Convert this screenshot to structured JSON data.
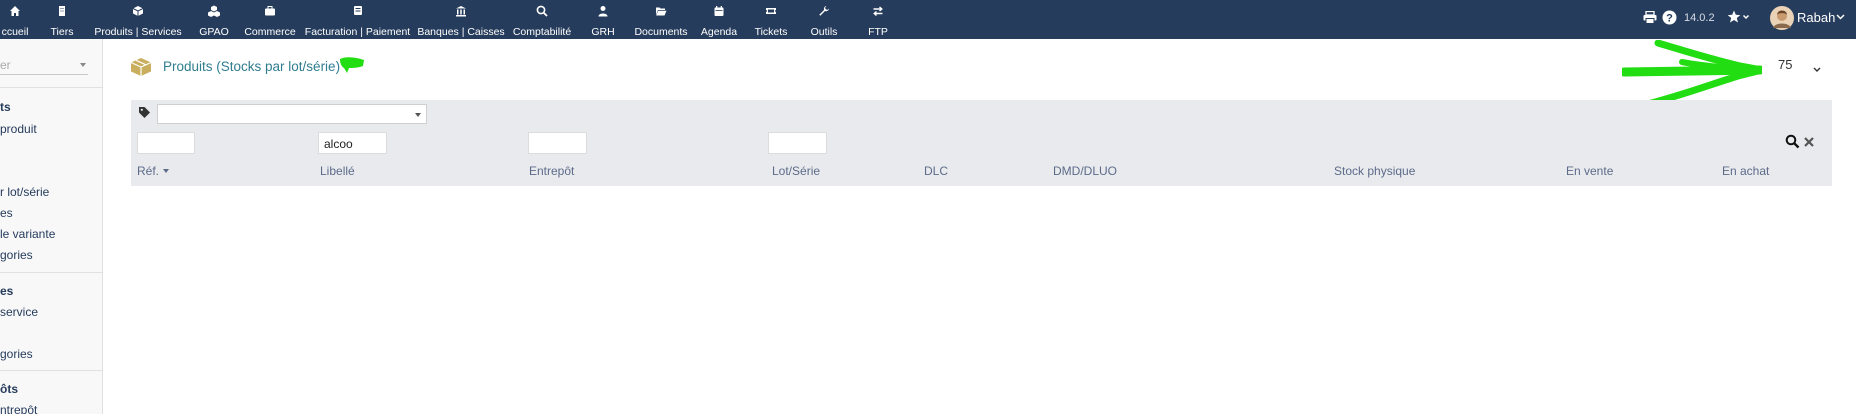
{
  "nav": {
    "items": [
      {
        "label": "ccueil",
        "icon": "home-icon"
      },
      {
        "label": "Tiers",
        "icon": "building-icon"
      },
      {
        "label": "Produits | Services",
        "icon": "cube-icon"
      },
      {
        "label": "GPAO",
        "icon": "cubes-icon"
      },
      {
        "label": "Commerce",
        "icon": "briefcase-icon"
      },
      {
        "label": "Facturation | Paiement",
        "icon": "money-check-icon"
      },
      {
        "label": "Banques | Caisses",
        "icon": "bank-icon"
      },
      {
        "label": "Comptabilité",
        "icon": "search-dollar-icon"
      },
      {
        "label": "GRH",
        "icon": "user-tie-icon"
      },
      {
        "label": "Documents",
        "icon": "folder-open-icon"
      },
      {
        "label": "Agenda",
        "icon": "calendar-icon"
      },
      {
        "label": "Tickets",
        "icon": "ticket-icon"
      },
      {
        "label": "Outils",
        "icon": "wrench-icon"
      },
      {
        "label": "FTP",
        "icon": "exchange-icon"
      }
    ],
    "version": "14.0.2",
    "user": "Rabah"
  },
  "sidebar": {
    "search_placeholder": "er",
    "items": [
      {
        "label": "ts",
        "kind": "head"
      },
      {
        "label": "produit",
        "kind": "link"
      },
      {
        "label": "r lot/série",
        "kind": "link"
      },
      {
        "label": "es",
        "kind": "link"
      },
      {
        "label": "le variante",
        "kind": "link"
      },
      {
        "label": "gories",
        "kind": "link"
      },
      {
        "label": "es",
        "kind": "head"
      },
      {
        "label": "service",
        "kind": "link"
      },
      {
        "label": "gories",
        "kind": "link"
      },
      {
        "label": "ôts",
        "kind": "head"
      },
      {
        "label": "ntrepôt",
        "kind": "link"
      }
    ]
  },
  "main": {
    "title": "Produits (Stocks par lot/série)",
    "limit": "75",
    "filters": {
      "ref": "",
      "label": "alcoo",
      "warehouse": "",
      "lot": ""
    },
    "columns": {
      "ref": "Réf.",
      "label": "Libellé",
      "warehouse": "Entrepôt",
      "lot": "Lot/Série",
      "dlc": "DLC",
      "dluo": "DMD/DLUO",
      "stock": "Stock physique",
      "tosell": "En vente",
      "tobuy": "En achat"
    }
  },
  "colors": {
    "topbar": "#263c5c",
    "title": "#2f7d8f",
    "annotation": "#22dd11",
    "filter_bg": "#e9eaed"
  }
}
